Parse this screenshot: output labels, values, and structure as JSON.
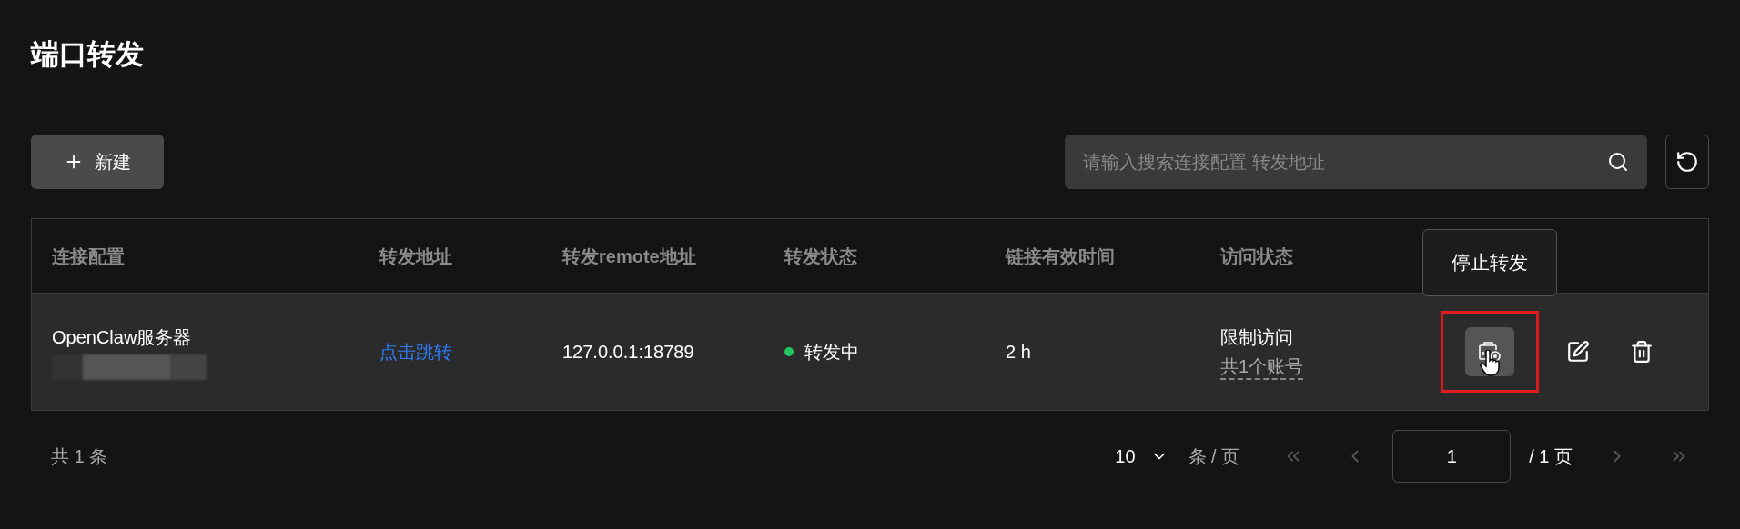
{
  "title": "端口转发",
  "toolbar": {
    "new_button": "新建",
    "search": {
      "placeholder": "请输入搜索连接配置 转发地址"
    }
  },
  "table": {
    "columns": [
      "连接配置",
      "转发地址",
      "转发remote地址",
      "转发状态",
      "链接有效时间",
      "访问状态"
    ],
    "rows": [
      {
        "name": "OpenClaw服务器",
        "name_redacted": true,
        "link": "点击跳转",
        "remote": "127.0.0.1:18789",
        "status": "转发中",
        "color": "#22c55e",
        "duration": "2 h",
        "access": "限制访问",
        "accounts": "共1个账号",
        "tooltip": "停止转发",
        "stop_hovered": true,
        "highlighted": true
      }
    ]
  },
  "pagination": {
    "total": "共 1 条",
    "page_size": "10",
    "page_size_unit": "条 / 页",
    "page": "1",
    "pages": "/ 1 页"
  }
}
